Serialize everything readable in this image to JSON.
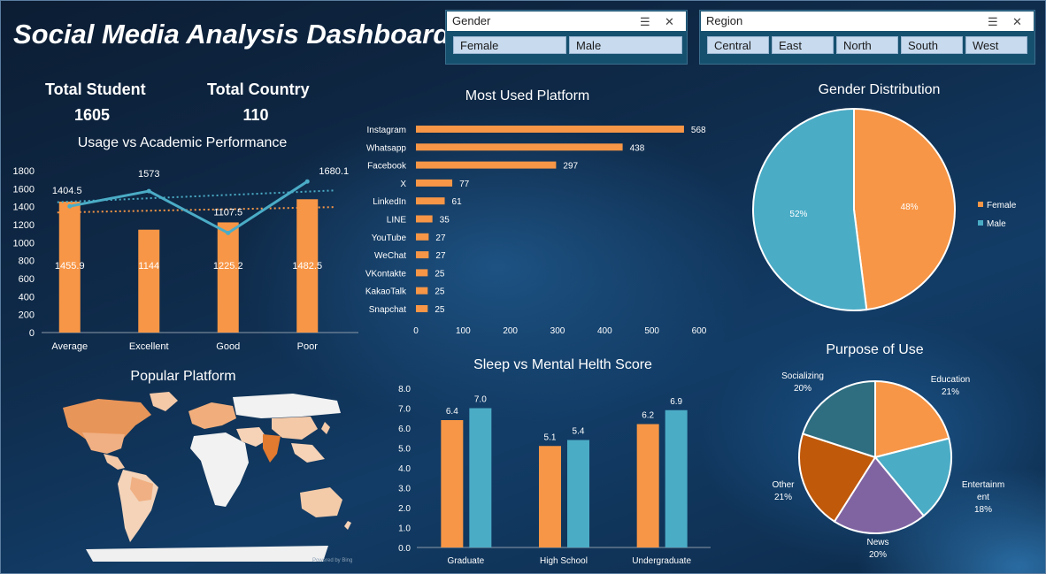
{
  "title": "Social Media Analysis Dashboard",
  "kpis": {
    "total_student_label": "Total Student",
    "total_student_value": "1605",
    "total_country_label": "Total Country",
    "total_country_value": "110"
  },
  "slicers": {
    "gender": {
      "label": "Gender",
      "items": [
        "Female",
        "Male"
      ]
    },
    "region": {
      "label": "Region",
      "items": [
        "Central",
        "East",
        "North",
        "South",
        "West"
      ]
    }
  },
  "map": {
    "title": "Popular Platform",
    "credit": "Powered by Bing"
  },
  "colors": {
    "orange": "#f79646",
    "teal": "#4bacc6",
    "text": "#ffffff"
  },
  "chart_data": [
    {
      "id": "usage",
      "type": "bar",
      "title": "Usage vs Academic Performance",
      "categories": [
        "Average",
        "Excellent",
        "Good",
        "Poor"
      ],
      "series": [
        {
          "kind": "bar",
          "values": [
            1455.9,
            1144,
            1225.2,
            1482.5
          ],
          "labels": [
            "1455.9",
            "1144",
            "1225.2",
            "1482.5"
          ]
        },
        {
          "kind": "line",
          "values": [
            1404.5,
            1573,
            1107.5,
            1680.1
          ],
          "labels": [
            "1404.5",
            "1573",
            "1107.5",
            "1680.1"
          ]
        }
      ],
      "trendlines": [
        {
          "of": "line",
          "from": 1450,
          "to": 1580
        },
        {
          "of": "bar",
          "from": 1335,
          "to": 1395
        }
      ],
      "ylim": [
        0,
        1800
      ],
      "yticks": [
        "0",
        "200",
        "400",
        "600",
        "800",
        "1000",
        "1200",
        "1400",
        "1600",
        "1800"
      ]
    },
    {
      "id": "platform",
      "type": "bar",
      "orientation": "horizontal",
      "title": "Most Used Platform",
      "categories": [
        "Instagram",
        "Whatsapp",
        "Facebook",
        "X",
        "LinkedIn",
        "LINE",
        "YouTube",
        "WeChat",
        "VKontakte",
        "KakaoTalk",
        "Snapchat"
      ],
      "values": [
        568,
        438,
        297,
        77,
        61,
        35,
        27,
        27,
        25,
        25,
        25
      ],
      "xlim": [
        0,
        600
      ],
      "xticks": [
        "0",
        "100",
        "200",
        "300",
        "400",
        "500",
        "600"
      ]
    },
    {
      "id": "gender",
      "type": "pie",
      "title": "Gender Distribution",
      "categories": [
        "Female",
        "Male"
      ],
      "values": [
        48,
        52
      ],
      "labels": [
        "48%",
        "52%"
      ],
      "legend": "right"
    },
    {
      "id": "sleep",
      "type": "bar",
      "title": "Sleep vs Mental Helth Score",
      "categories": [
        "Graduate",
        "High School",
        "Undergraduate"
      ],
      "series": [
        {
          "values": [
            6.4,
            5.1,
            6.2
          ],
          "labels": [
            "6.4",
            "5.1",
            "6.2"
          ]
        },
        {
          "values": [
            7.0,
            5.4,
            6.9
          ],
          "labels": [
            "7.0",
            "5.4",
            "6.9"
          ]
        }
      ],
      "ylim": [
        0,
        8
      ],
      "yticks": [
        "0.0",
        "1.0",
        "2.0",
        "3.0",
        "4.0",
        "5.0",
        "6.0",
        "7.0",
        "8.0"
      ]
    },
    {
      "id": "purpose",
      "type": "pie",
      "title": "Purpose of Use",
      "categories": [
        "Education",
        "Entertainm ent",
        "News",
        "Other",
        "Socializing"
      ],
      "values": [
        21,
        18,
        20,
        21,
        20
      ],
      "labels": [
        "21%",
        "18%",
        "20%",
        "21%",
        "20%"
      ],
      "colors": [
        "#f79646",
        "#4bacc6",
        "#8064a2",
        "#c0590a",
        "#2f6e80"
      ]
    }
  ]
}
